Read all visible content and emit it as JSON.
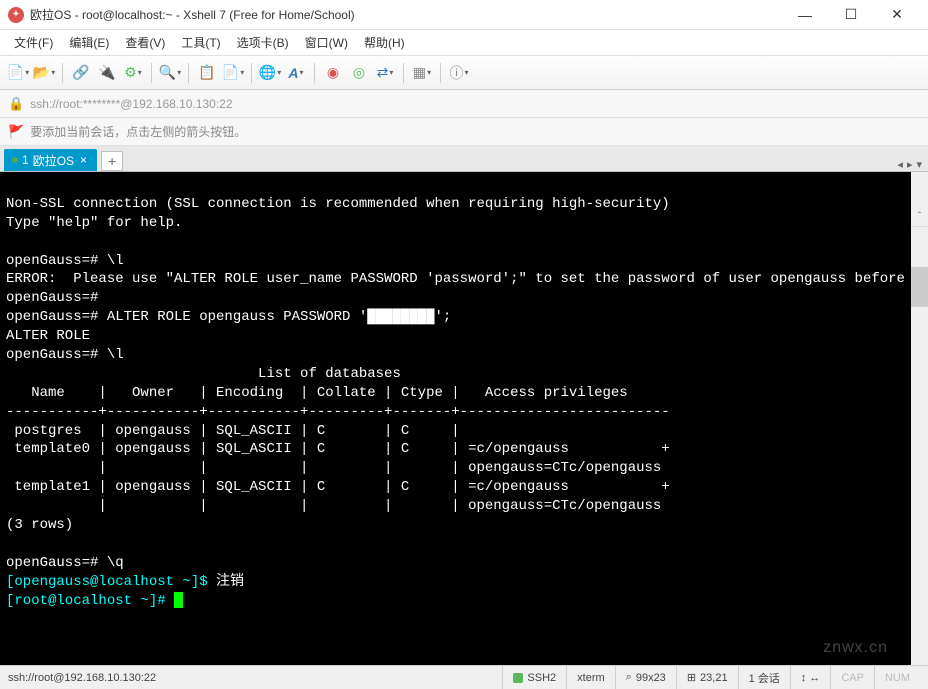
{
  "window": {
    "title": "欧拉OS - root@localhost:~ - Xshell 7 (Free for Home/School)"
  },
  "menu": {
    "file": "文件(F)",
    "edit": "编辑(E)",
    "view": "查看(V)",
    "tools": "工具(T)",
    "tabs": "选项卡(B)",
    "window": "窗口(W)",
    "help": "帮助(H)"
  },
  "address": "ssh://root:********@192.168.10.130:22",
  "tip": "要添加当前会话，点击左侧的箭头按钮。",
  "tab": {
    "index": "1",
    "name": "欧拉OS"
  },
  "terminal": {
    "lines": [
      "Non-SSL connection (SSL connection is recommended when requiring high-security)",
      "Type \"help\" for help.",
      "",
      "openGauss=# \\l",
      "ERROR:  Please use \"ALTER ROLE user_name PASSWORD 'password';\" to set the password of user opengauss before other operation!",
      "openGauss=#",
      "openGauss=# ALTER ROLE opengauss PASSWORD '████████';",
      "ALTER ROLE",
      "openGauss=# \\l",
      "                              List of databases",
      "   Name    |   Owner   | Encoding  | Collate | Ctype |   Access privileges",
      "-----------+-----------+-----------+---------+-------+-------------------------",
      " postgres  | opengauss | SQL_ASCII | C       | C     |",
      " template0 | opengauss | SQL_ASCII | C       | C     | =c/opengauss           +",
      "           |           |           |         |       | opengauss=CTc/opengauss",
      " template1 | opengauss | SQL_ASCII | C       | C     | =c/opengauss           +",
      "           |           |           |         |       | opengauss=CTc/opengauss",
      "(3 rows)",
      "",
      "openGauss=# \\q"
    ],
    "prompt_user": "[opengauss@localhost ~]$ ",
    "prompt_user_cmd": "注销",
    "prompt_root": "[root@localhost ~]# "
  },
  "watermark": "znwx.cn",
  "status": {
    "conn": "ssh://root@192.168.10.130:22",
    "proto": "SSH2",
    "term": "xterm",
    "size": "99x23",
    "pos": "23,21",
    "sessions": "1 会话",
    "cap": "CAP",
    "num": "NUM"
  }
}
